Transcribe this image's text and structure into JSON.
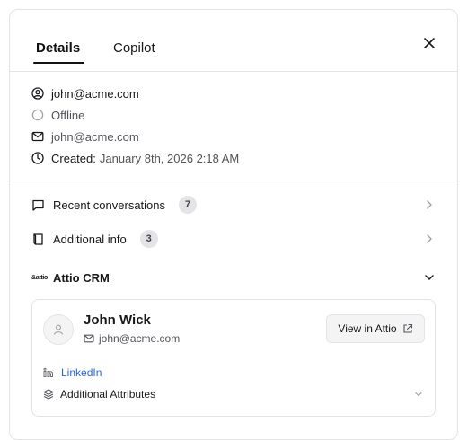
{
  "tabs": {
    "details": "Details",
    "copilot": "Copilot"
  },
  "contact": {
    "username": "john@acme.com",
    "status": "Offline",
    "email": "john@acme.com",
    "created_label": "Created:",
    "created_value": "January 8th, 2026 2:18 AM"
  },
  "sections": {
    "recent_conversations": {
      "label": "Recent conversations",
      "count": "7"
    },
    "additional_info": {
      "label": "Additional info",
      "count": "3"
    },
    "crm": {
      "label": "Attio CRM",
      "logo_text": "&attio"
    }
  },
  "crm_card": {
    "name": "John Wick",
    "email": "john@acme.com",
    "view_button": "View in Attio",
    "linkedin": "LinkedIn",
    "attributes": "Additional Attributes"
  },
  "colors": {
    "link": "#2563eb",
    "border": "#e4e4e7",
    "badge_bg": "#e4e4e7"
  }
}
